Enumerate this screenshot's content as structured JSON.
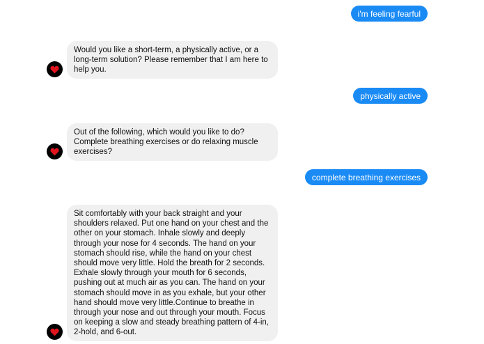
{
  "messages": [
    {
      "sender": "user",
      "text": "i'm feeling fearful"
    },
    {
      "sender": "bot",
      "text": "Would you like a short-term, a physically active, or a long-term solution? Please remember that I am here to help you."
    },
    {
      "sender": "user",
      "text": "physically active"
    },
    {
      "sender": "bot",
      "text": "Out of the following, which would you like to do? Complete breathing exercises or do relaxing muscle exercises?"
    },
    {
      "sender": "user",
      "text": "complete breathing exercises"
    },
    {
      "sender": "bot",
      "text": "Sit comfortably with your back straight and your shoulders relaxed. Put one hand on your chest and the other on your stomach. Inhale slowly and deeply through your nose for 4 seconds. The hand on your stomach should rise, while the hand on your chest should move very little. Hold the breath for 2 seconds. Exhale slowly through your mouth for 6 seconds, pushing out at much air as you can. The hand on your stomach should move in as you exhale, but your other hand should move very little.Continue to breathe in through your nose and out through your mouth. Focus on keeping a slow and steady breathing pattern of 4-in, 2-hold, and 6-out."
    }
  ],
  "colors": {
    "user_bubble": "#1a8bf5",
    "bot_bubble": "#f0f0f0",
    "avatar_bg": "#000000",
    "heart": "#e0141e"
  },
  "icons": {
    "bot_avatar": "heart-icon"
  }
}
